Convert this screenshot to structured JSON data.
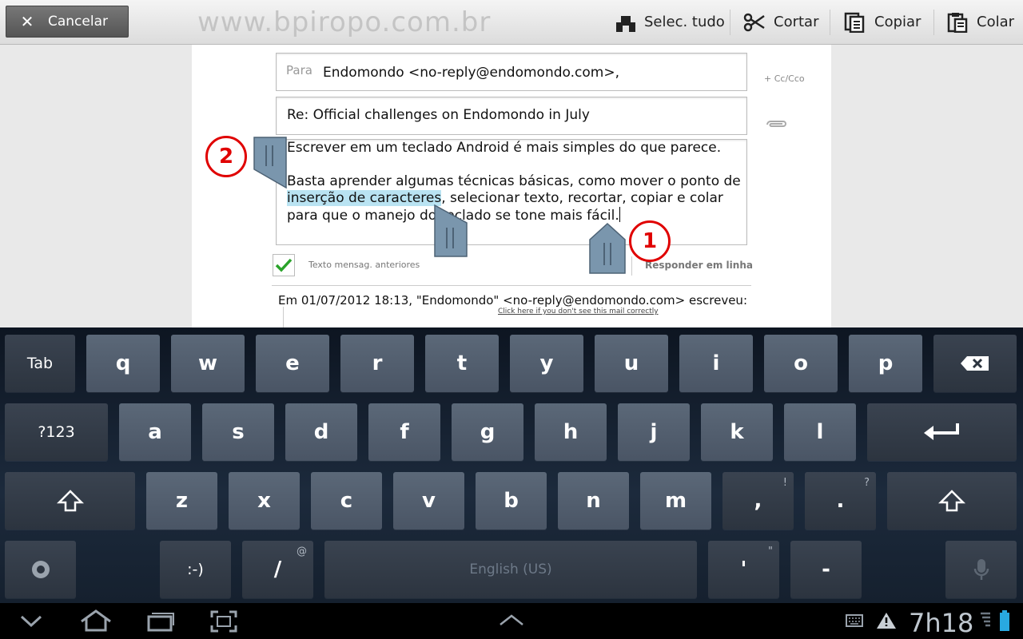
{
  "topbar": {
    "cancel_label": "Cancelar",
    "watermark": "www.bpiropo.com.br",
    "actions": {
      "select_all": "Selec. tudo",
      "cut": "Cortar",
      "copy": "Copiar",
      "paste": "Colar"
    }
  },
  "compose": {
    "to_label": "Para",
    "to_value": "Endomondo <no-reply@endomondo.com>,",
    "cc_bcc": "+ Cc/Cco",
    "subject": "Re: Official challenges on Endomondo in July",
    "body": {
      "line1": "Escrever em um teclado Android é mais simples do que parece.",
      "line2_pre": "Basta aprender algumas técnicas básicas, como mover o ponto de",
      "selected": "inserção de caracteres",
      "line3_post": ", selecionar texto, recortar, copiar e colar",
      "line4": "para que o manejo do teclado se tone mais fácil."
    },
    "quote_label": "Texto mensag. anteriores",
    "quote_checked": true,
    "inline_label": "Responder em linha",
    "quote_header": "Em 01/07/2012 18:13, \"Endomondo\" <no-reply@endomondo.com> escreveu:",
    "quote_link": "Click here if you don't see this mail correctly"
  },
  "markers": {
    "one": "1",
    "two": "2"
  },
  "keyboard": {
    "row1": [
      "Tab",
      "q",
      "w",
      "e",
      "r",
      "t",
      "y",
      "u",
      "i",
      "o",
      "p"
    ],
    "row2": [
      "?123",
      "a",
      "s",
      "d",
      "f",
      "g",
      "h",
      "j",
      "k",
      "l"
    ],
    "row3": [
      "z",
      "x",
      "c",
      "v",
      "b",
      "n",
      "m",
      ",",
      "."
    ],
    "row3_hints": [
      "!",
      "?"
    ],
    "row4": [
      ":-)",
      "/",
      "'",
      "-"
    ],
    "row4_hints": [
      "@",
      "\""
    ],
    "space_label": "English (US)"
  },
  "statusbar": {
    "time": "7h18"
  },
  "colors": {
    "selection": "#b9e3f2",
    "marker": "#e00000",
    "check": "#2aa32a"
  }
}
